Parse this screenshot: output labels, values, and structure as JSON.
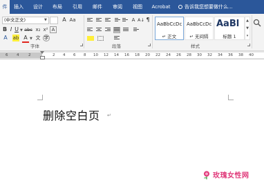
{
  "tabs": [
    "件",
    "插入",
    "设计",
    "布局",
    "引用",
    "邮件",
    "审阅",
    "视图",
    "Acrobat"
  ],
  "tell_me": "告诉我您想要做什么...",
  "font": {
    "name": "(中文正文)",
    "bold": "B",
    "italic": "I",
    "underline": "U",
    "strike": "abc",
    "subscript": "x₂",
    "superscript": "x²",
    "char_border": "A",
    "font_color": "A",
    "grow": "A",
    "change_case": "Aa",
    "highlight": "ab",
    "phonetic": "文",
    "enclose": "字",
    "group_label": "字体"
  },
  "paragraph": {
    "group_label": "段落",
    "sort": "A↓",
    "show_marks": "¶",
    "chinese_layout": "A"
  },
  "styles": {
    "group_label": "样式",
    "items": [
      {
        "sample": "AaBbCcDc",
        "name": "↵ 正文",
        "selected": true
      },
      {
        "sample": "AaBbCcDc",
        "name": "↵ 无间隔",
        "selected": false
      },
      {
        "sample": "AaBl",
        "name": "标题 1",
        "selected": false
      }
    ],
    "scroll_up": "▲",
    "scroll_down": "▼",
    "more": "▾"
  },
  "ruler": {
    "left_ticks": [
      "6",
      "4",
      "2"
    ],
    "right_ticks": [
      "2",
      "4",
      "6",
      "8",
      "10",
      "12",
      "14",
      "16",
      "18",
      "20",
      "22",
      "24",
      "26",
      "28",
      "30",
      "32",
      "34",
      "36",
      "38",
      "40"
    ]
  },
  "document": {
    "text": "删除空白页",
    "para_mark": "↵"
  },
  "watermark": {
    "text": "玫瑰女性网",
    "color": "#e0397a"
  },
  "colors": {
    "ribbon_blue": "#2b579a",
    "ribbon_bg": "#f3f3f3"
  }
}
